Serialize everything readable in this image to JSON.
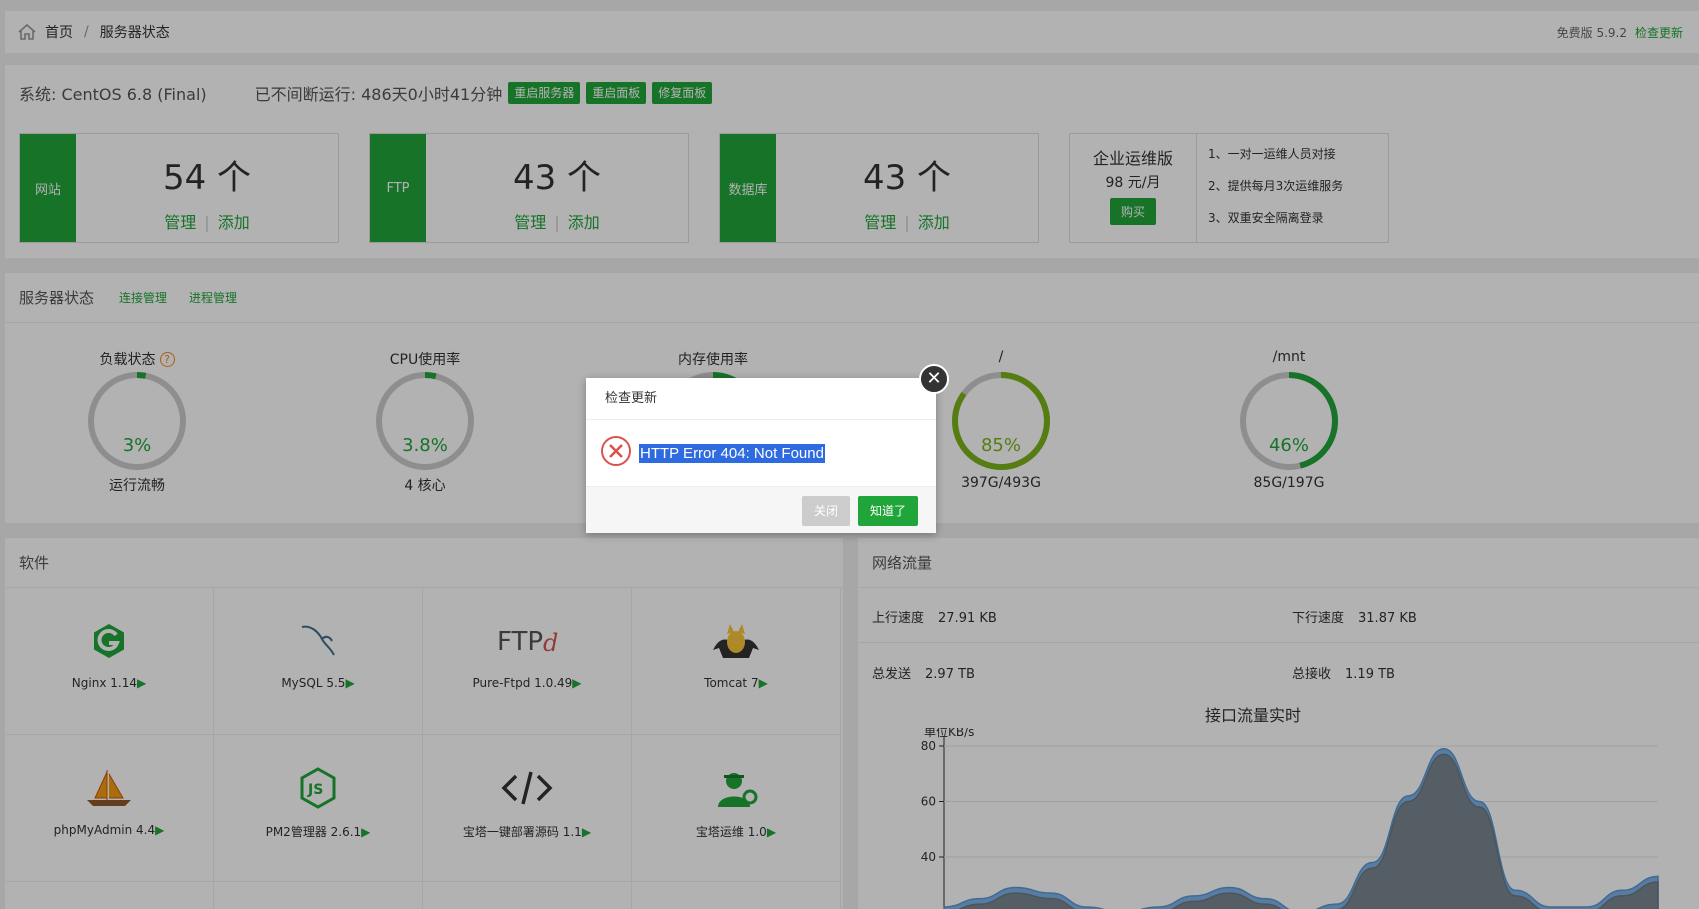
{
  "breadcrumb": {
    "home": "首页",
    "sep": "/",
    "current": "服务器状态"
  },
  "version": {
    "label": "免费版 5.9.2",
    "check": "检查更新"
  },
  "system": {
    "os": "系统: CentOS 6.8 (Final)",
    "uptime": "已不间断运行: 486天0小时41分钟",
    "buttons": [
      "重启服务器",
      "重启面板",
      "修复面板"
    ]
  },
  "stats": [
    {
      "tag": "网站",
      "count": "54 个",
      "manage": "管理",
      "add": "添加"
    },
    {
      "tag": "FTP",
      "count": "43 个",
      "manage": "管理",
      "add": "添加"
    },
    {
      "tag": "数据库",
      "count": "43 个",
      "manage": "管理",
      "add": "添加"
    }
  ],
  "enterprise": {
    "title": "企业运维版",
    "price": "98 元/月",
    "buy": "购买",
    "features": [
      "1、一对一运维人员对接",
      "2、提供每月3次运维服务",
      "3、双重安全隔离登录"
    ]
  },
  "server_status": {
    "title": "服务器状态",
    "links": [
      "连接管理",
      "进程管理"
    ],
    "help": "?"
  },
  "gauges": [
    {
      "title": "负载状态",
      "value": "3%",
      "sub": "运行流畅",
      "percent": 3,
      "color": "#20a53a"
    },
    {
      "title": "CPU使用率",
      "value": "3.8%",
      "sub": "4 核心",
      "percent": 3.8,
      "color": "#20a53a"
    },
    {
      "title": "内存使用率",
      "value": "",
      "sub": "",
      "percent": 30,
      "color": "#20a53a"
    },
    {
      "title": "/",
      "value": "85%",
      "sub": "397G/493G",
      "percent": 85,
      "color": "#7bb31a"
    },
    {
      "title": "/mnt",
      "value": "46%",
      "sub": "85G/197G",
      "percent": 46,
      "color": "#20a53a"
    }
  ],
  "software": {
    "title": "软件",
    "items": [
      {
        "name": "Nginx 1.14",
        "icon": "nginx-icon"
      },
      {
        "name": "MySQL 5.5",
        "icon": "mysql-icon"
      },
      {
        "name": "Pure-Ftpd 1.0.49",
        "icon": "ftp-icon"
      },
      {
        "name": "Tomcat 7",
        "icon": "tomcat-icon"
      },
      {
        "name": "phpMyAdmin 4.4",
        "icon": "phpmyadmin-icon"
      },
      {
        "name": "PM2管理器 2.6.1",
        "icon": "nodejs-icon"
      },
      {
        "name": "宝塔一键部署源码 1.1",
        "icon": "code-icon"
      },
      {
        "name": "宝塔运维 1.0",
        "icon": "ops-icon"
      }
    ],
    "arrow": "▶"
  },
  "network": {
    "title": "网络流量",
    "up_label": "上行速度",
    "up": "27.91 KB",
    "down_label": "下行速度",
    "down": "31.87 KB",
    "sent_label": "总发送",
    "sent": "2.97 TB",
    "recv_label": "总接收",
    "recv": "1.19 TB"
  },
  "chart_data": {
    "type": "area",
    "title": "接口流量实时",
    "ylabel": "单位KB/s",
    "ylim": [
      0,
      80
    ],
    "yticks": [
      40,
      60,
      80
    ],
    "x": [
      0,
      1,
      2,
      3,
      4,
      5,
      6,
      7,
      8,
      9,
      10,
      11,
      12,
      13,
      14,
      15,
      16,
      17,
      18,
      19,
      20
    ],
    "series": [
      {
        "values": [
          22,
          25,
          29,
          27,
          22,
          20,
          22,
          26,
          29,
          25,
          20,
          23,
          38,
          62,
          79,
          60,
          28,
          22,
          22,
          28,
          33
        ]
      },
      {
        "values": [
          20,
          23,
          27,
          25,
          20,
          18,
          20,
          24,
          27,
          23,
          18,
          21,
          36,
          60,
          77,
          58,
          26,
          20,
          20,
          26,
          31
        ]
      }
    ]
  },
  "dialog": {
    "title": "检查更新",
    "message": "HTTP Error 404: Not Found",
    "close": "关闭",
    "ok": "知道了",
    "x": "✕"
  }
}
